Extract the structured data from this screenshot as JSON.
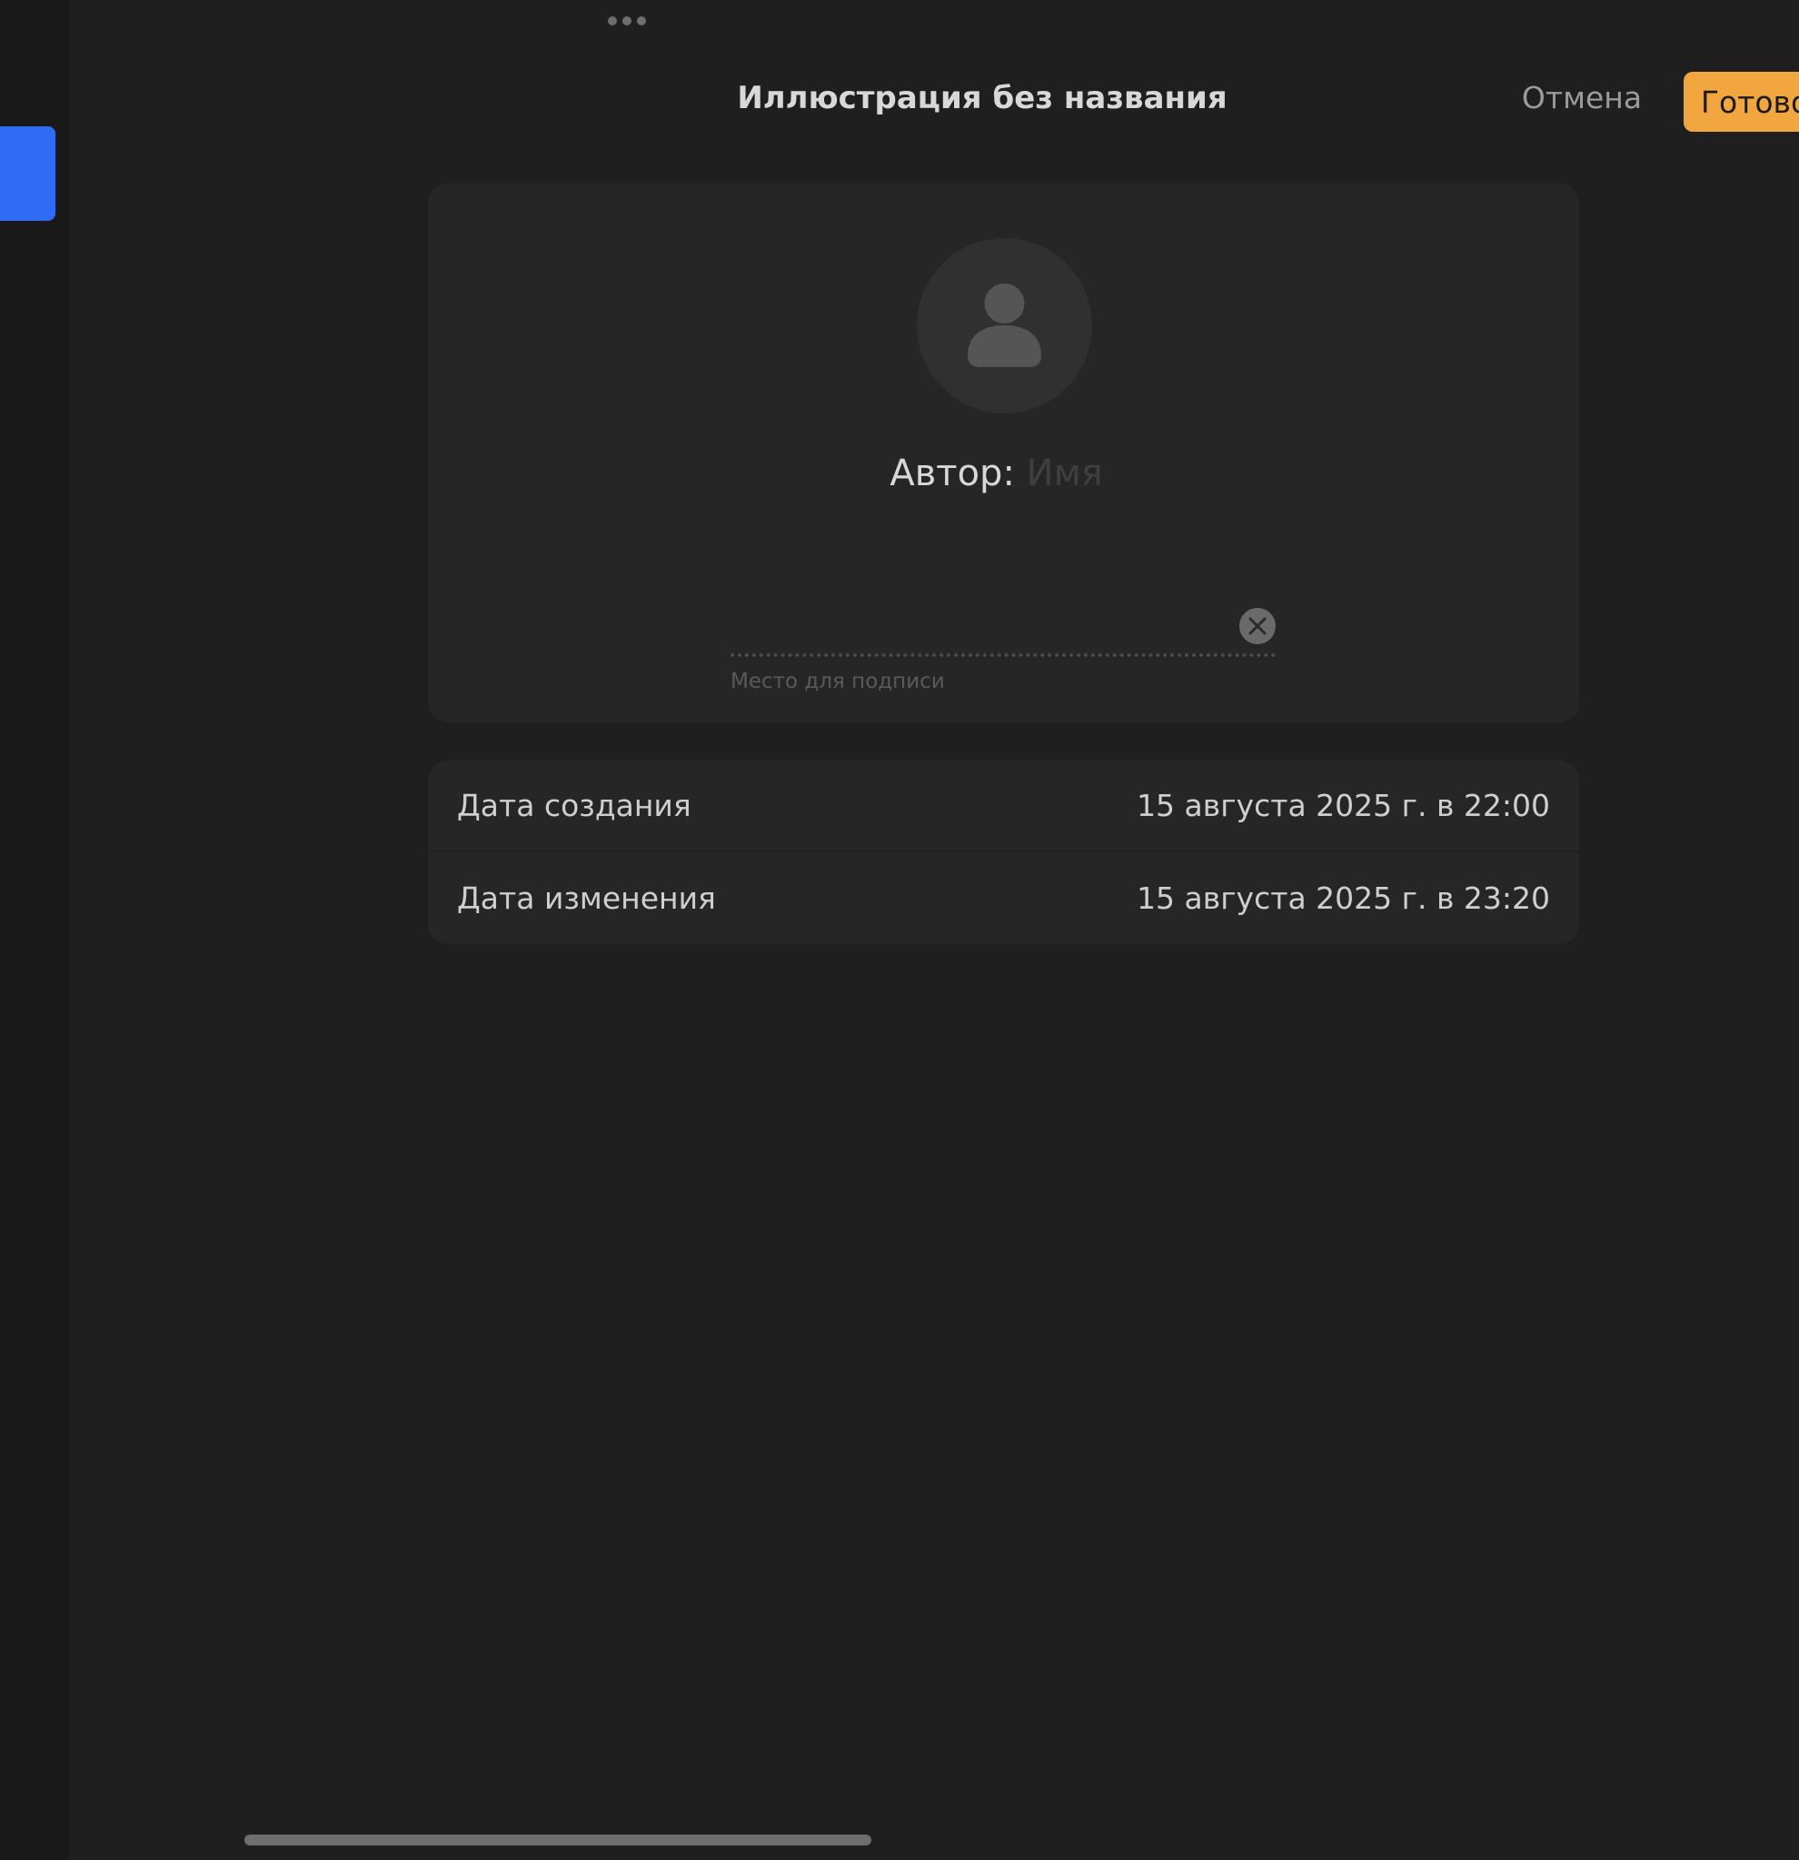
{
  "header": {
    "title": "Иллюстрация без названия",
    "cancel_label": "Отмена",
    "done_label": "Готово"
  },
  "author": {
    "label": "Автор:",
    "name_value": "",
    "name_placeholder": "Имя",
    "signature_label": "Место для подписи"
  },
  "dates": [
    {
      "label": "Дата создания",
      "value": "15 августа 2025 г. в 22:00"
    },
    {
      "label": "Дата изменения",
      "value": "15 августа 2025 г. в 23:20"
    }
  ],
  "icons": {
    "avatar": "person-icon",
    "clear": "close-icon",
    "grabber": "more-dots-icon"
  },
  "colors": {
    "accent": "#f2a640",
    "side_tab": "#2f6cf6",
    "background": "#1f1f1f",
    "card": "#262626"
  }
}
